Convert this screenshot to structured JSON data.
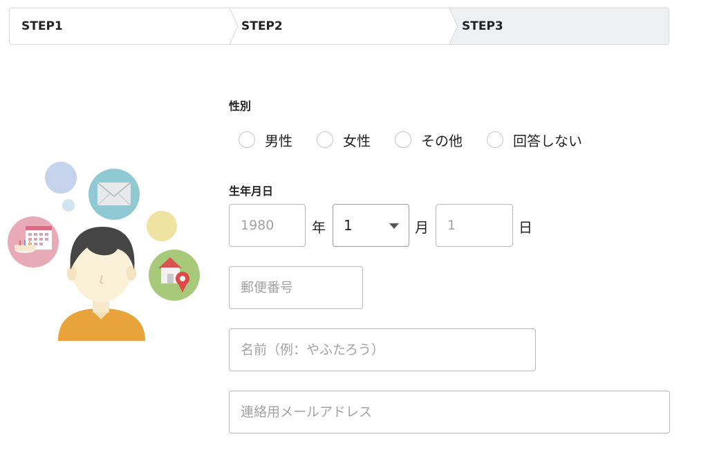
{
  "steps": [
    {
      "label": "STEP1"
    },
    {
      "label": "STEP2"
    },
    {
      "label": "STEP3"
    }
  ],
  "gender": {
    "label": "性別",
    "options": [
      "男性",
      "女性",
      "その他",
      "回答しない"
    ]
  },
  "birthdate": {
    "label": "生年月日",
    "year_placeholder": "1980",
    "year_unit": "年",
    "month_value": "1",
    "month_unit": "月",
    "day_placeholder": "1",
    "day_unit": "日"
  },
  "postal_code": {
    "placeholder": "郵便番号"
  },
  "name": {
    "placeholder": "名前（例：やふたろう）"
  },
  "email": {
    "placeholder": "連絡用メールアドレス"
  },
  "colors": {
    "active_step_bg": "#eff0f4",
    "border": "#d8d8d8",
    "shirt": "#e8a43a",
    "hair": "#444444",
    "envelope_circle": "#8fc9d3",
    "calendar_circle": "#e9aab8",
    "home_circle": "#a8c97a"
  },
  "icons": [
    "envelope-icon",
    "calendar-icon",
    "home-pin-icon",
    "person-avatar"
  ]
}
